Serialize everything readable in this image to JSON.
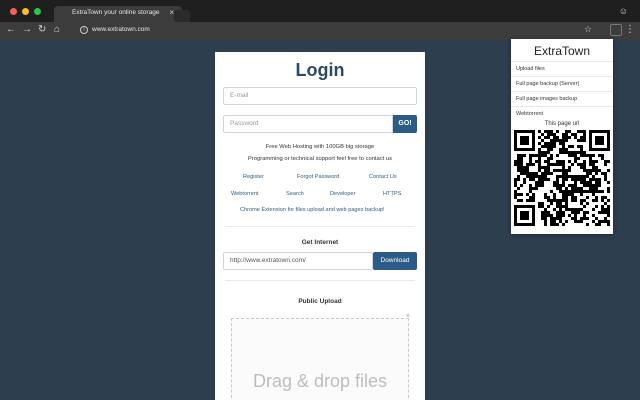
{
  "browser": {
    "tab_title": "ExtraTown your online storage",
    "tab_close": "×",
    "url": "www.extratown.com"
  },
  "icons": {
    "back": "back-arrow-icon",
    "forward": "forward-arrow-icon",
    "reload": "reload-icon",
    "home": "home-icon",
    "info": "info-icon",
    "star": "star-icon",
    "menu": "menu-dots-icon",
    "account": "account-icon"
  },
  "colors": {
    "page_bg": "#2d3e4f",
    "accent": "#2c5c86",
    "title": "#2e4964"
  },
  "login": {
    "title": "Login",
    "email_placeholder": "E-mail",
    "password_placeholder": "Password",
    "go_label": "GO!",
    "info_line1": "Free Web Hosting with 100GB big storage",
    "info_line2": "Programming or technical support feel free to contact us",
    "links_row1": [
      "Register",
      "Forgot Password",
      "Contact Us"
    ],
    "links_row2": [
      "Webtorrent",
      "Search",
      "Developer",
      "HTTPS"
    ],
    "chrome_ext_link": "Chrome Extension for files upload and web pages backup!"
  },
  "get_internet": {
    "label": "Get Internet",
    "url_placeholder": "http://www.extratown.com/",
    "download_label": "Download"
  },
  "public_upload": {
    "label": "Public Upload",
    "dropzone_text": "Drag & drop files",
    "close": "×"
  },
  "popup": {
    "title": "ExtraTown",
    "items": [
      "Upload files",
      "Full page backup (Server)",
      "Full page images backup",
      "Webtorrent"
    ],
    "qr_caption": "This page url"
  }
}
